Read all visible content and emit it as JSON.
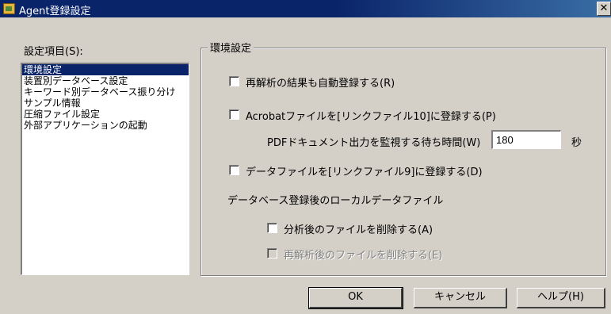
{
  "window": {
    "title": "Agent登録設定",
    "close_glyph": "✕"
  },
  "left_panel": {
    "label": "設定項目(S):",
    "items": [
      {
        "label": "環境設定",
        "selected": true
      },
      {
        "label": "装置別データベース設定",
        "selected": false
      },
      {
        "label": "キーワード別データベース振り分け",
        "selected": false
      },
      {
        "label": "サンプル情報",
        "selected": false
      },
      {
        "label": "圧縮ファイル設定",
        "selected": false
      },
      {
        "label": "外部アプリケーションの起動",
        "selected": false
      }
    ]
  },
  "group": {
    "title": "環境設定",
    "reanalysis_register": {
      "label": "再解析の結果も自動登録する(R)",
      "checked": false
    },
    "acrobat_link10": {
      "label": "Acrobatファイルを[リンクファイル10]に登録する(P)",
      "checked": false
    },
    "pdf_wait": {
      "label": "PDFドキュメント出力を監視する待ち時間(W)",
      "value": "180",
      "unit": "秒"
    },
    "data_link9": {
      "label": "データファイルを[リンクファイル9]に登録する(D)",
      "checked": false
    },
    "local_section_label": "データベース登録後のローカルデータファイル",
    "delete_after_analysis": {
      "label": "分析後のファイルを削除する(A)",
      "checked": false
    },
    "delete_after_reanalysis": {
      "label": "再解析後のファイルを削除する(E)",
      "checked": false,
      "disabled": true
    }
  },
  "buttons": {
    "ok": "OK",
    "cancel": "キャンセル",
    "help": "ヘルプ(H)"
  }
}
